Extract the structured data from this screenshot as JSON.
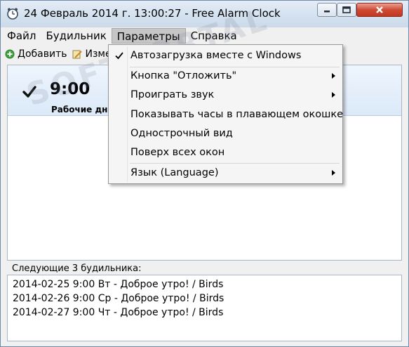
{
  "window": {
    "title": "24 Февраль 2014 г. 13:00:27 - Free Alarm Clock"
  },
  "menubar": {
    "items": [
      "Файл",
      "Будильник",
      "Параметры",
      "Справка"
    ]
  },
  "toolbar": {
    "add_label": "Добавить",
    "edit_label": "Изме"
  },
  "alarm": {
    "time": "9:00",
    "days": "Рабочие дни"
  },
  "dropdown": {
    "items": [
      {
        "label": "Автозагрузка вместе с Windows",
        "checked": true,
        "submenu": false
      },
      {
        "label": "Кнопка \"Отложить\"",
        "checked": false,
        "submenu": true
      },
      {
        "label": "Проиграть звук",
        "checked": false,
        "submenu": true
      },
      {
        "label": "Показывать часы в плавающем окошке",
        "checked": false,
        "submenu": false
      },
      {
        "label": "Однострочный вид",
        "checked": false,
        "submenu": false
      },
      {
        "label": "Поверх всех окон",
        "checked": false,
        "submenu": false
      },
      {
        "label": "Язык (Language)",
        "checked": false,
        "submenu": true
      }
    ]
  },
  "next_alarms": {
    "label": "Следующие 3 будильника:",
    "items": [
      "2014-02-25 9:00 Вт - Доброе утро! / Birds",
      "2014-02-26 9:00 Ср - Доброе утро! / Birds",
      "2014-02-27 9:00 Чт - Доброе утро! / Birds"
    ]
  },
  "watermark": "SOFTPORTAL",
  "colors": {
    "titlebar": "#d3e1ef",
    "close_button": "#c03721",
    "selected_row": "#dbe9f8",
    "menu_active": "#c6c6c6"
  }
}
